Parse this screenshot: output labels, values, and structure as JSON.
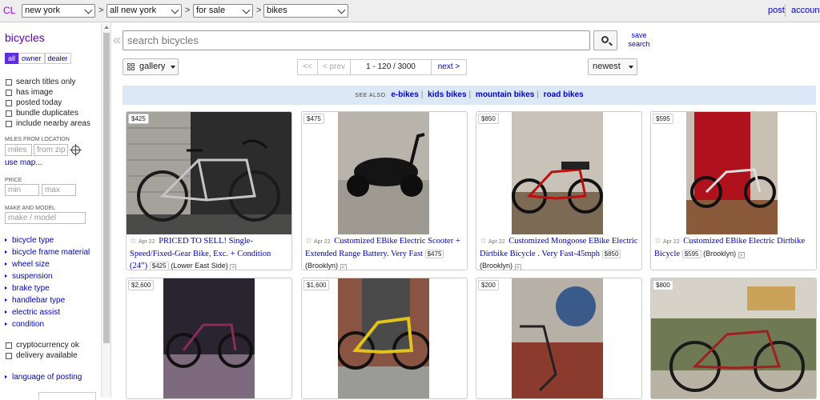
{
  "topbar": {
    "logo": "CL",
    "crumbs": [
      "new york",
      "all new york",
      "for sale",
      "bikes"
    ],
    "post": "post",
    "account": "account"
  },
  "sidebar": {
    "title": "bicycles",
    "segments": [
      "all",
      "owner",
      "dealer"
    ],
    "checks": [
      "search titles only",
      "has image",
      "posted today",
      "bundle duplicates",
      "include nearby areas"
    ],
    "miles_label": "MILES FROM LOCATION",
    "miles_ph": "miles",
    "zip_ph": "from zip",
    "use_map": "use map...",
    "price_label": "PRICE",
    "min_ph": "min",
    "max_ph": "max",
    "make_label": "MAKE AND MODEL",
    "make_ph": "make / model",
    "categories": [
      "bicycle type",
      "bicycle frame material",
      "wheel size",
      "suspension",
      "brake type",
      "handlebar type",
      "electric assist",
      "condition"
    ],
    "checks2": [
      "cryptocurrency ok",
      "delivery available"
    ],
    "language": "language of posting"
  },
  "search": {
    "placeholder": "search bicycles",
    "save1": "save",
    "save2": "search"
  },
  "controls": {
    "view": "gallery",
    "first": "<<",
    "prev": "< prev",
    "range": "1 - 120 / 3000",
    "next": "next >",
    "sort": "newest"
  },
  "see_also": {
    "label": "SEE ALSO",
    "links": [
      "e-bikes",
      "kids bikes",
      "mountain bikes",
      "road bikes"
    ]
  },
  "listings": [
    {
      "price": "$425",
      "date": "Apr 22",
      "title": "PRICED TO SELL! Single-Speed/Fixed-Gear Bike, Exc. + Condition (24”)",
      "hood": "(Lower East Side)"
    },
    {
      "price": "$475",
      "date": "Apr 22",
      "title": "Customized EBike Electric Scooter + Extended Range Battery. Very Fast",
      "hood": "(Brooklyn)"
    },
    {
      "price": "$850",
      "date": "Apr 22",
      "title": "Customized Mongoose EBike Electric Dirtbike Bicycle . Very Fast-45mph",
      "hood": "(Brooklyn)"
    },
    {
      "price": "$595",
      "date": "Apr 22",
      "title": "Customized EBike Electric Dirtbike Bicycle",
      "hood": "(Brooklyn)"
    },
    {
      "price": "$2,600"
    },
    {
      "price": "$1,600"
    },
    {
      "price": "$200"
    },
    {
      "price": "$800"
    }
  ],
  "colors": {
    "accent": "#6200c4",
    "link": "#0000cc",
    "see_also_bg": "#dde8f7"
  }
}
